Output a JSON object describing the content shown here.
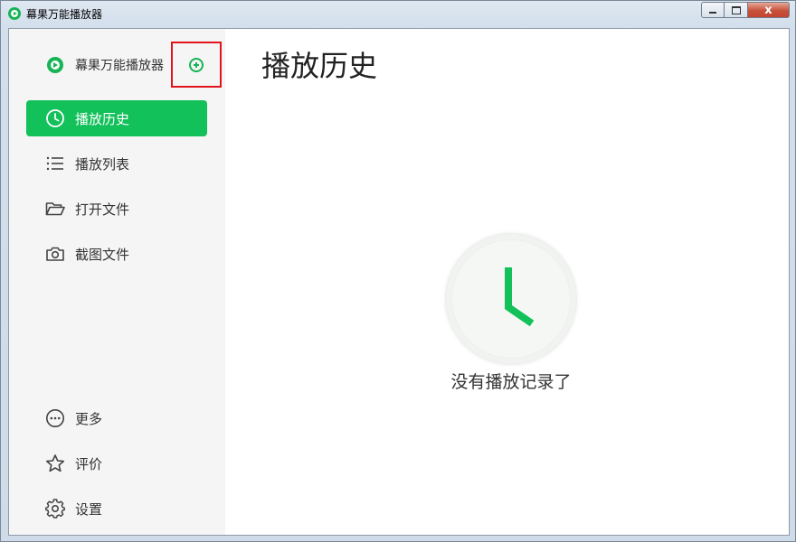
{
  "window": {
    "title": "幕果万能播放器",
    "minimize_label": "",
    "maximize_label": "",
    "close_label": "x"
  },
  "sidebar": {
    "brand_name": "幕果万能播放器",
    "add_icon": "plus-circle-icon",
    "items": [
      {
        "label": "播放历史",
        "icon": "clock-icon",
        "active": true
      },
      {
        "label": "播放列表",
        "icon": "list-icon",
        "active": false
      },
      {
        "label": "打开文件",
        "icon": "folder-open-icon",
        "active": false
      },
      {
        "label": "截图文件",
        "icon": "camera-icon",
        "active": false
      }
    ],
    "bottom_items": [
      {
        "label": "更多",
        "icon": "more-circle-icon"
      },
      {
        "label": "评价",
        "icon": "star-icon"
      },
      {
        "label": "设置",
        "icon": "gear-icon"
      }
    ]
  },
  "main": {
    "title": "播放历史",
    "empty_message": "没有播放记录了",
    "empty_icon": "clock-icon"
  },
  "colors": {
    "accent": "#12c15a",
    "highlight_box": "#e0151c"
  }
}
